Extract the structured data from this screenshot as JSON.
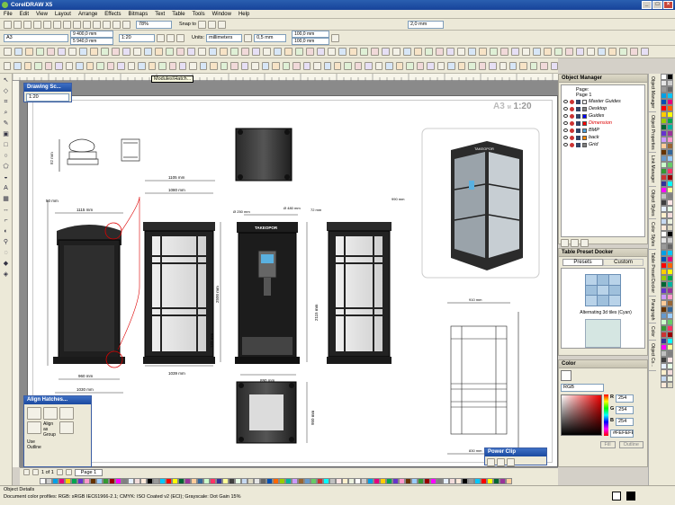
{
  "app": {
    "title": "CorelDRAW X5"
  },
  "menu": [
    "File",
    "Edit",
    "View",
    "Layout",
    "Arrange",
    "Effects",
    "Bitmaps",
    "Text",
    "Table",
    "Tools",
    "Window",
    "Help"
  ],
  "standard_bar": {
    "zoom": "78%",
    "snap_label": "Snap to",
    "outline_width": "2,0 mm"
  },
  "property_bar": {
    "paper": "A3",
    "width": "420,0 mm",
    "height": "297,0 mm",
    "scale": "1:20",
    "units_label": "Units:",
    "units": "millimeters",
    "nudge": "0,5 mm",
    "dup_x": "100,0 mm",
    "dup_y": "100,0 mm",
    "pos_x": "9 400,0 mm",
    "pos_y": "5 940,0 mm"
  },
  "tooltip": "Modules\\Hatch...",
  "drawing_scale": {
    "title": "Drawing Sc...",
    "value": "1:20"
  },
  "sheet": {
    "format": "A3",
    "scale": "1:20"
  },
  "dims": {
    "d1115a": "1115 mm",
    "d1105": "1105 mm",
    "d1080": "1080 mm",
    "d990": "990 mm",
    "d960": "960 mm",
    "d1030": "1030 mm",
    "d1039": "1039 mm",
    "d890": "890 mm",
    "d2500": "2500 mm",
    "d2115": "2115 mm",
    "d950": "950 mm",
    "d830": "830 mm",
    "d910": "910 mm",
    "d82": "82 mm",
    "d50": "50 mm",
    "d250": "Ø 250 mm",
    "d480": "Ø 480 mm",
    "d72": "72 mm",
    "d122": "122 mm"
  },
  "booth_sign": "TAKEOPOR",
  "object_manager": {
    "title": "Object Manager",
    "page_label": "Page:",
    "page_name": "Page 1",
    "layers": [
      {
        "name": "Master Guides",
        "color": "#ffffff"
      },
      {
        "name": "Desktop",
        "color": "#808080"
      },
      {
        "name": "Guides",
        "color": "#0000ff"
      },
      {
        "name": "Dimension",
        "color": "#ff0000",
        "highlight": true
      },
      {
        "name": "BMP",
        "color": "#4b9fd9"
      },
      {
        "name": "back",
        "color": "#ff8800"
      },
      {
        "name": "Grid",
        "color": "#808080"
      }
    ]
  },
  "table_preset": {
    "title": "Table Preset Docker",
    "tabs": [
      "Presets",
      "Custom"
    ],
    "preset_label": "Alternating 3d tiles (Cyan)"
  },
  "color_docker": {
    "title": "Color",
    "model": "RGB",
    "r": "254",
    "g": "254",
    "b": "254",
    "hex": "#FEFEFE",
    "buttons": [
      "Fill",
      "Outline"
    ]
  },
  "align_docker": {
    "title": "Align Hatches...",
    "align_group_label": "Align as Group",
    "use_outline_label": "Use Outline"
  },
  "power_clip": {
    "title": "Power Clip"
  },
  "page_nav": {
    "counter": "1 of 1",
    "tab": "Page 1"
  },
  "side_tabs": [
    "Object Manager",
    "Object Properties",
    "Link Manager",
    "Object Styles",
    "Color Styles",
    "Table Preset Docker",
    "Paragraph",
    "Color",
    "Object Co..."
  ],
  "status": {
    "object_details": "Object Details",
    "profiles": "Document color profiles: RGB: sRGB IEC61966-2.1; CMYK: ISO Coated v2 (ECI); Grayscale: Dot Gain 15%"
  },
  "palette_colors": [
    "#ffffff",
    "#000000",
    "#e6e6e6",
    "#cccccc",
    "#999999",
    "#666666",
    "#00a0e6",
    "#00c8ff",
    "#0050b4",
    "#e6007e",
    "#ff0000",
    "#ff6600",
    "#ffcc00",
    "#ffff00",
    "#99cc00",
    "#00a651",
    "#006633",
    "#00b4a0",
    "#6633cc",
    "#993399",
    "#cc99ff",
    "#ff99cc",
    "#ffcc99",
    "#996633",
    "#663300",
    "#336699",
    "#6699cc",
    "#99ccff",
    "#ccffcc",
    "#66cc66",
    "#339933",
    "#ff3366",
    "#cc3333",
    "#990000",
    "#333399",
    "#00ffff",
    "#ff00ff",
    "#ffff99",
    "#c0c0c0",
    "#808080",
    "#404040",
    "#ffe6e6",
    "#e6f0ff",
    "#e6ffe6",
    "#fff0cc",
    "#f2dcdb",
    "#c6d9f1",
    "#ebf1de",
    "#fde9d9",
    "#ddd9c3"
  ]
}
